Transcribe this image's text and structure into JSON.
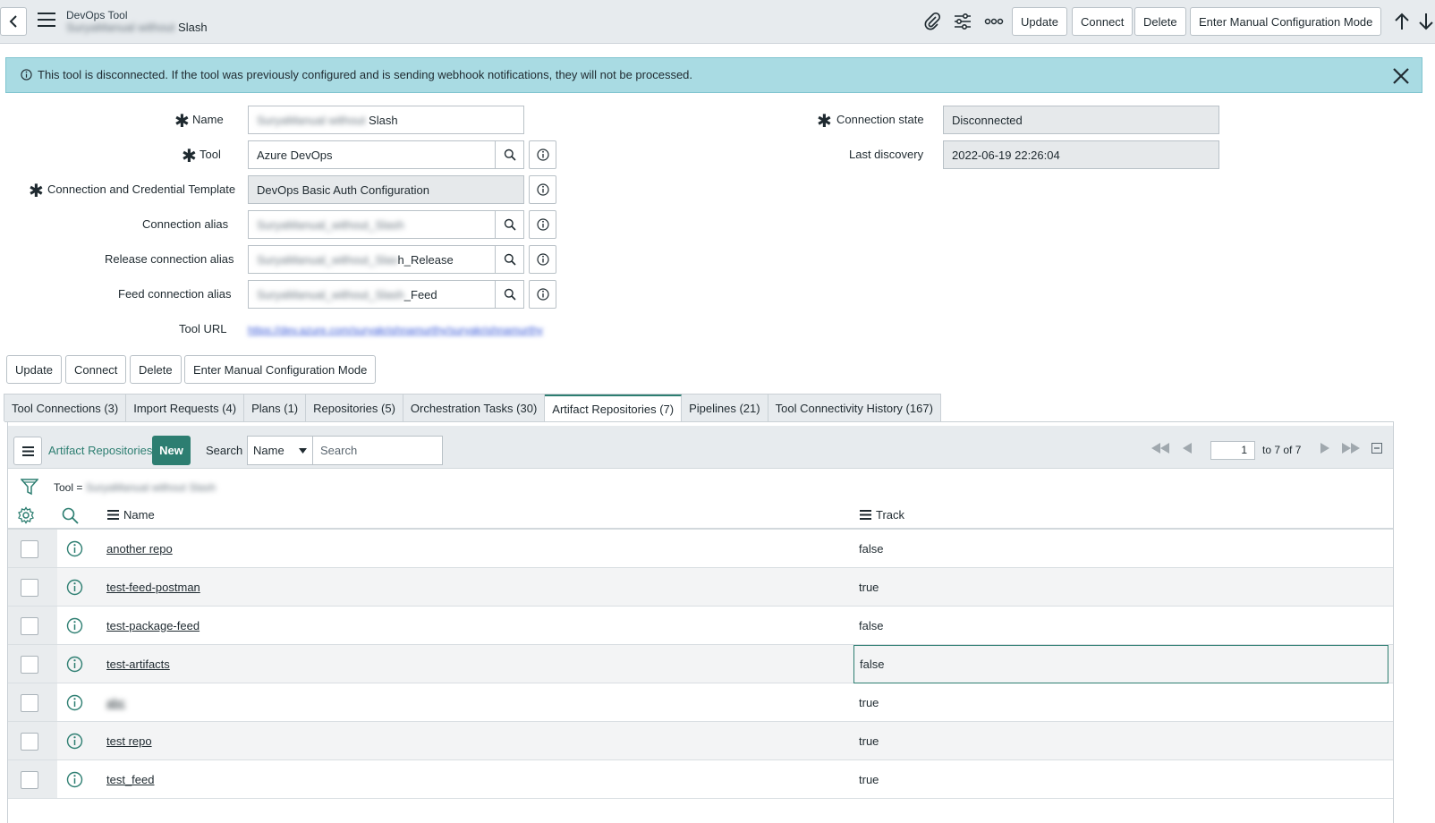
{
  "header": {
    "record_type": "DevOps Tool",
    "record_name_blurred": "SuryaManual without",
    "record_name": "Slash",
    "buttons": [
      "Update",
      "Connect",
      "Delete",
      "Enter Manual Configuration Mode"
    ],
    "icons": [
      "back-icon",
      "menu-icon",
      "attachment-icon",
      "settings-sliders-icon",
      "more-icon",
      "arrow-up-icon",
      "arrow-down-icon"
    ]
  },
  "alert": {
    "text": "This tool is disconnected. If the tool was previously configured and is sending webhook notifications, they will not be processed.",
    "color": "#a9dbe3"
  },
  "form": {
    "name": {
      "label": "Name",
      "value_blurred": "SuryaManual without",
      "value": "Slash"
    },
    "tool": {
      "label": "Tool",
      "value": "Azure DevOps"
    },
    "credential_template": {
      "label": "Connection and Credential Template",
      "value": "DevOps Basic Auth Configuration"
    },
    "connection_alias": {
      "label": "Connection alias",
      "value_blurred": "SuryaManual_without_Slash"
    },
    "release_alias": {
      "label": "Release connection alias",
      "value_blurred": "SuryaManual_without_Slas",
      "value": "h_Release"
    },
    "feed_alias": {
      "label": "Feed connection alias",
      "value_blurred": "SuryaManual_without_Slash",
      "value": "_Feed"
    },
    "tool_url": {
      "label": "Tool URL",
      "value_blurred": "https://dev.azure.com/suryakrishnamurthy/suryakrishnamurthy"
    },
    "connection_state": {
      "label": "Connection state",
      "value": "Disconnected"
    },
    "last_discovery": {
      "label": "Last discovery",
      "value": "2022-06-19 22:26:04"
    },
    "buttons": [
      "Update",
      "Connect",
      "Delete",
      "Enter Manual Configuration Mode"
    ]
  },
  "tabs": [
    {
      "label": "Tool Connections (3)"
    },
    {
      "label": "Import Requests (4)"
    },
    {
      "label": "Plans (1)"
    },
    {
      "label": "Repositories (5)"
    },
    {
      "label": "Orchestration Tasks (30)"
    },
    {
      "label": "Artifact Repositories (7)",
      "active": true
    },
    {
      "label": "Pipelines (21)"
    },
    {
      "label": "Tool Connectivity History (167)"
    }
  ],
  "list": {
    "title": "Artifact Repositories",
    "new_label": "New",
    "search_label": "Search",
    "search_field": "Name",
    "search_placeholder": "Search",
    "page_value": "1",
    "page_of": "to 7 of 7",
    "filter_label": "Tool =",
    "filter_value_blurred": "SuryaManual without Slash",
    "columns": [
      "Name",
      "Track"
    ],
    "rows": [
      {
        "name": "another repo",
        "track": "false"
      },
      {
        "name": "test-feed-postman",
        "track": "true"
      },
      {
        "name": "test-package-feed",
        "track": "false"
      },
      {
        "name": "test-artifacts",
        "track": "false",
        "selected": true
      },
      {
        "name": "abc",
        "track": "true",
        "blurred": true
      },
      {
        "name": "test repo",
        "track": "true"
      },
      {
        "name": "test_feed",
        "track": "true"
      }
    ],
    "accent": "#2d7e71"
  }
}
